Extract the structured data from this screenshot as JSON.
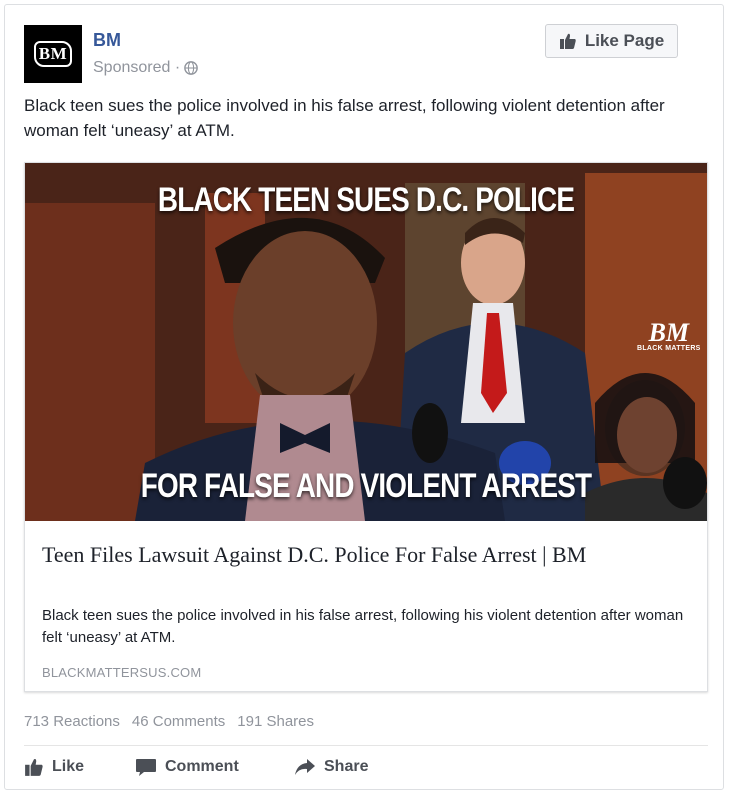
{
  "post": {
    "page_name": "BM",
    "sponsored_label": "Sponsored ·",
    "avatar_text": "BM",
    "like_page_label": "Like Page",
    "text": "Black teen sues the police involved in his false arrest, following violent detention after woman felt ‘uneasy’ at ATM."
  },
  "link": {
    "image_headline_top": "BLACK TEEN SUES D.C. POLICE",
    "image_headline_bottom": "FOR FALSE AND VIOLENT ARREST",
    "image_logo_main": "BM",
    "image_logo_sub": "BLACK MATTERS",
    "title": "Teen Files Lawsuit Against D.C. Police For False Arrest | BM",
    "description": "Black teen sues the police involved in his false arrest, following his violent detention after woman felt ‘uneasy’ at ATM.",
    "domain": "BLACKMATTERSUS.COM"
  },
  "stats": {
    "reactions": "713 Reactions",
    "comments": "46 Comments",
    "shares": "191 Shares"
  },
  "actions": {
    "like": "Like",
    "comment": "Comment",
    "share": "Share"
  },
  "icons": {
    "globe": "globe-icon",
    "thumbs_up": "thumbs-up-icon",
    "comment": "comment-icon",
    "share": "share-arrow-icon"
  },
  "colors": {
    "page_name": "#365899",
    "muted": "#90949c",
    "action_text": "#4b4f56"
  }
}
